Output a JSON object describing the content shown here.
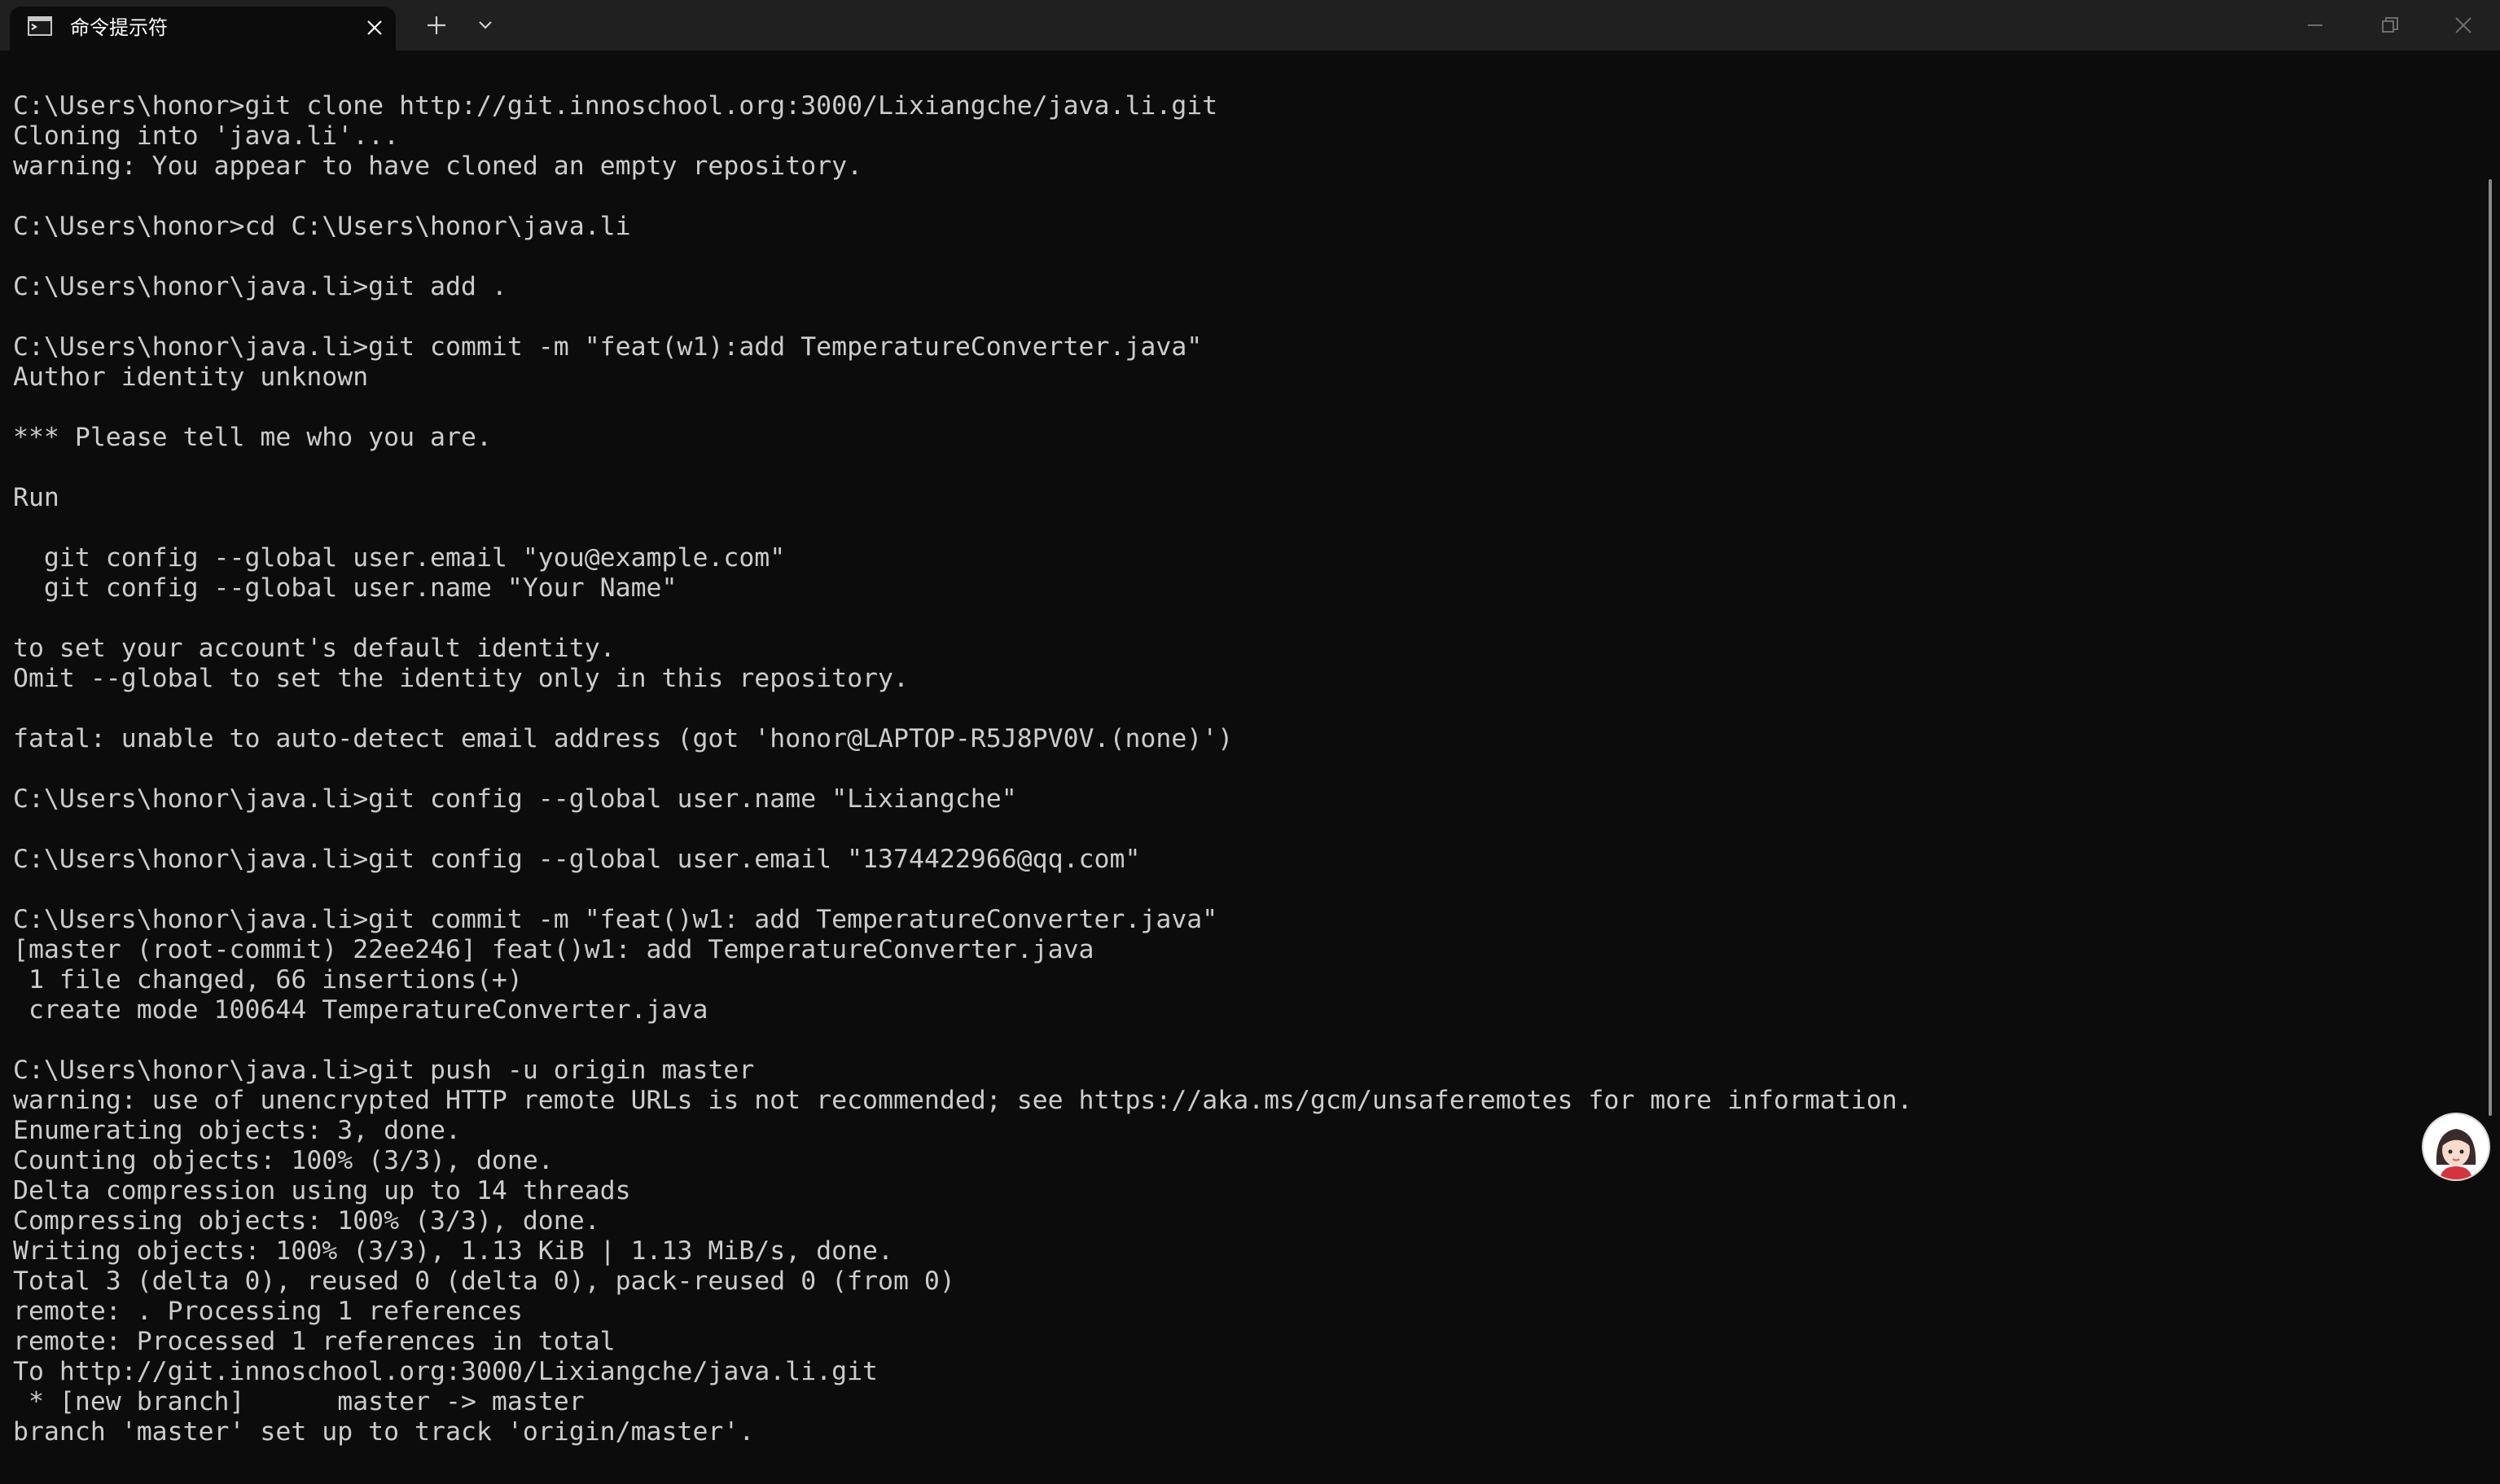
{
  "window": {
    "tab_title": "命令提示符",
    "tab_icon": "terminal-icon",
    "close_tab_icon": "close-icon",
    "new_tab_icon": "plus-icon",
    "dropdown_icon": "chevron-down-icon",
    "minimize_icon": "minimize-icon",
    "restore_icon": "restore-icon",
    "close_window_icon": "close-icon",
    "background_color": "#0c0c0c",
    "titlebar_color": "#202020",
    "text_color": "#cccccc"
  },
  "terminal": {
    "text": "C:\\Users\\honor>git clone http://git.innoschool.org:3000/Lixiangche/java.li.git\nCloning into 'java.li'...\nwarning: You appear to have cloned an empty repository.\n\nC:\\Users\\honor>cd C:\\Users\\honor\\java.li\n\nC:\\Users\\honor\\java.li>git add .\n\nC:\\Users\\honor\\java.li>git commit -m \"feat(w1):add TemperatureConverter.java\"\nAuthor identity unknown\n\n*** Please tell me who you are.\n\nRun\n\n  git config --global user.email \"you@example.com\"\n  git config --global user.name \"Your Name\"\n\nto set your account's default identity.\nOmit --global to set the identity only in this repository.\n\nfatal: unable to auto-detect email address (got 'honor@LAPTOP-R5J8PV0V.(none)')\n\nC:\\Users\\honor\\java.li>git config --global user.name \"Lixiangche\"\n\nC:\\Users\\honor\\java.li>git config --global user.email \"1374422966@qq.com\"\n\nC:\\Users\\honor\\java.li>git commit -m \"feat()w1: add TemperatureConverter.java\"\n[master (root-commit) 22ee246] feat()w1: add TemperatureConverter.java\n 1 file changed, 66 insertions(+)\n create mode 100644 TemperatureConverter.java\n\nC:\\Users\\honor\\java.li>git push -u origin master\nwarning: use of unencrypted HTTP remote URLs is not recommended; see https://aka.ms/gcm/unsaferemotes for more information.\nEnumerating objects: 3, done.\nCounting objects: 100% (3/3), done.\nDelta compression using up to 14 threads\nCompressing objects: 100% (3/3), done.\nWriting objects: 100% (3/3), 1.13 KiB | 1.13 MiB/s, done.\nTotal 3 (delta 0), reused 0 (delta 0), pack-reused 0 (from 0)\nremote: . Processing 1 references\nremote: Processed 1 references in total\nTo http://git.innoschool.org:3000/Lixiangche/java.li.git\n * [new branch]      master -> master\nbranch 'master' set up to track 'origin/master'."
  },
  "floating_assistant": {
    "icon": "avatar-icon"
  }
}
